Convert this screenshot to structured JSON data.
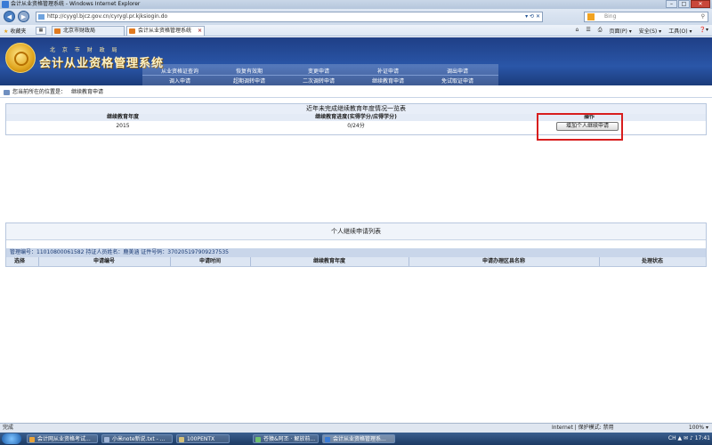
{
  "window": {
    "title": "会计从业资格管理系统 - Windows Internet Explorer",
    "min": "–",
    "max": "□",
    "close": "✕"
  },
  "address": {
    "url": "http://cyygl.bjcz.gov.cn/cyrygl.pr.kjksiogin.do",
    "tools": "▾ ⟲ ✕"
  },
  "search": {
    "placeholder": "Bing"
  },
  "favorites": {
    "label": "收藏夹"
  },
  "tabs": [
    {
      "label": "北京市财政局"
    },
    {
      "label": "会计从业资格管理系统"
    }
  ],
  "command_bar": {
    "page": "页面(P) ▾",
    "safety": "安全(S) ▾",
    "tools": "工具(O) ▾",
    "help": "❓▾"
  },
  "header": {
    "org": "北 京 市 财 政 局",
    "system_name": "会计从业资格管理系统",
    "menu_row1": [
      "从业资格证查询",
      "恢复有效期",
      "变更申请",
      "补证申请",
      "调出申请"
    ],
    "menu_row2": [
      "调入申请",
      "超期调转申请",
      "二次调转申请",
      "继续教育申请",
      "免试取证申请"
    ]
  },
  "breadcrumb": {
    "prefix": "您当前所在的位置是：",
    "current": "继续教育申请"
  },
  "panel_incomplete": {
    "title": "近年未完成继续教育年度情况一览表",
    "columns": [
      "继续教育年度",
      "继续教育进度(实得学分/应得学分)",
      "操作"
    ],
    "rows": [
      {
        "year": "2015",
        "progress": "0/24分",
        "action": "增加个人继续申请"
      }
    ]
  },
  "panel_applications": {
    "title": "个人继续申请列表",
    "user_info": "管理编号：11010800061582  持证人员姓名：鹿美涵  证件号码：370205197909237535",
    "columns": [
      "选择",
      "申请编号",
      "申请时间",
      "继续教育年度",
      "申请办理区县名称",
      "处理状态"
    ]
  },
  "statusbar": {
    "left": "完成",
    "zone": "Internet | 保护模式: 禁用",
    "zoom": "100% ▾"
  },
  "taskbar": {
    "items": [
      "会计网从业资格考试...",
      "小米note新说.txt - ...",
      "100PENTX",
      "苍猿&阿丕 · 解放前...",
      "会计从业资格管理系..."
    ],
    "tray": "CH  ▲  ✉  ♪  17:41"
  },
  "colors": {
    "highlight": "#d81e1e",
    "header_blue": "#2a56a8",
    "logo_gold": "#e0a51e"
  }
}
